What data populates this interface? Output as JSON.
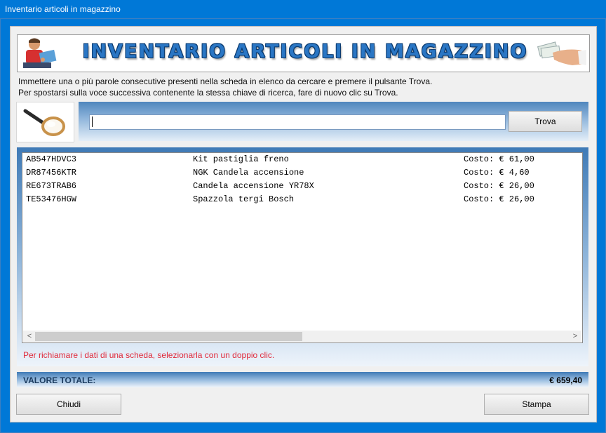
{
  "window": {
    "title": "Inventario articoli in magazzino"
  },
  "banner": {
    "heading": "INVENTARIO ARTICOLI IN MAGAZZINO"
  },
  "instructions": {
    "line1": "Immettere una o più parole consecutive presenti nella scheda in elenco da cercare e premere il pulsante Trova.",
    "line2": "Per spostarsi sulla voce successiva contenente la stessa chiave di ricerca, fare di nuovo clic su Trova."
  },
  "search": {
    "value": "",
    "button_label": "Trova"
  },
  "list": {
    "rows": [
      {
        "code": "AB547HDVC3",
        "description": "Kit pastiglia freno",
        "cost": "Costo: € 61,00"
      },
      {
        "code": "DR87456KTR",
        "description": "NGK Candela accensione",
        "cost": "Costo: € 4,60"
      },
      {
        "code": "RE673TRAB6",
        "description": "Candela accensione YR78X",
        "cost": "Costo: € 26,00"
      },
      {
        "code": "TE53476HGW",
        "description": "Spazzola tergi Bosch",
        "cost": "Costo: € 26,00"
      }
    ],
    "scroll_left": "<",
    "scroll_right": ">"
  },
  "hint": "Per richiamare i dati di una scheda, selezionarla con un doppio clic.",
  "total": {
    "label": "VALORE TOTALE:",
    "value": "€ 659,40"
  },
  "footer": {
    "close_label": "Chiudi",
    "print_label": "Stampa"
  },
  "colors": {
    "titlebar": "#0078d7",
    "hint": "#e0293a",
    "banner_text": "#2a76c4"
  }
}
